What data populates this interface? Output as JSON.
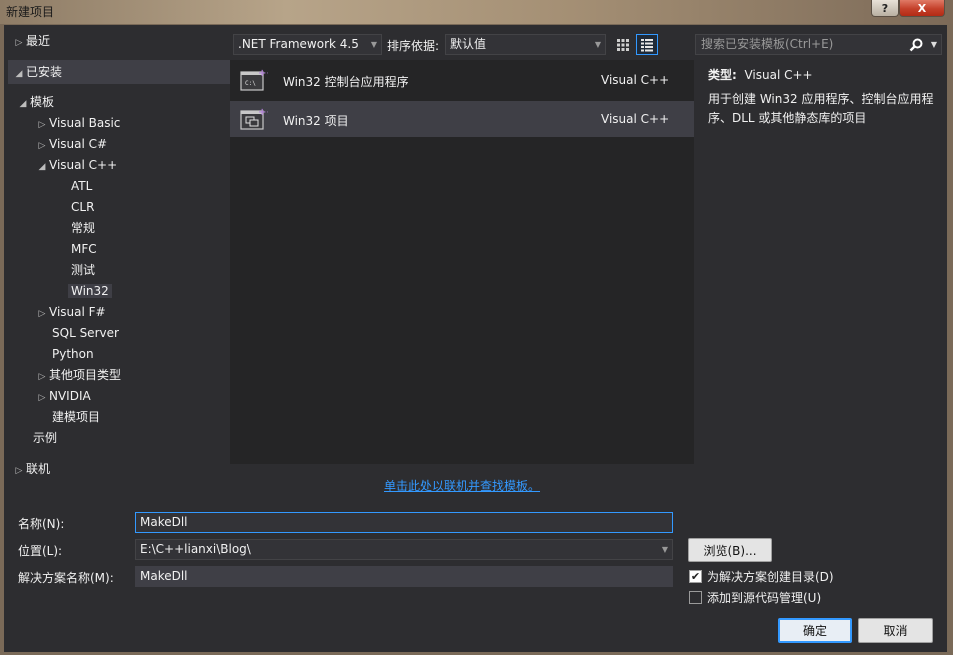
{
  "window": {
    "title": "新建项目",
    "help_glyph": "?",
    "close_glyph": "X"
  },
  "tree": {
    "recent": "最近",
    "installed": "已安装",
    "templates": "模板",
    "visual_basic": "Visual Basic",
    "visual_csharp": "Visual C#",
    "visual_cpp": "Visual C++",
    "cpp_children": [
      "ATL",
      "CLR",
      "常规",
      "MFC",
      "测试",
      "Win32"
    ],
    "visual_fsharp": "Visual F#",
    "sql_server": "SQL Server",
    "python": "Python",
    "other_types": "其他项目类型",
    "nvidia": "NVIDIA",
    "modeling": "建模项目",
    "samples": "示例",
    "online": "联机"
  },
  "toolbar": {
    "framework": ".NET Framework 4.5",
    "sort_label": "排序依据:",
    "sort_value": "默认值",
    "search_placeholder": "搜索已安装模板(Ctrl+E)"
  },
  "templates": [
    {
      "name": "Win32 控制台应用程序",
      "lang": "Visual C++"
    },
    {
      "name": "Win32 项目",
      "lang": "Visual C++"
    }
  ],
  "description": {
    "type_label": "类型:",
    "type_value": "Visual C++",
    "text": "用于创建 Win32 应用程序、控制台应用程序、DLL 或其他静态库的项目"
  },
  "online_link": "单击此处以联机并查找模板。",
  "form": {
    "name_label": "名称(N):",
    "name_value": "MakeDll",
    "location_label": "位置(L):",
    "location_value": "E:\\C++lianxi\\Blog\\",
    "solution_label": "解决方案名称(M):",
    "solution_value": "MakeDll",
    "browse": "浏览(B)...",
    "create_dir": "为解决方案创建目录(D)",
    "create_dir_checked": true,
    "add_source_control": "添加到源代码管理(U)",
    "add_source_control_checked": false,
    "ok": "确定",
    "cancel": "取消"
  },
  "colors": {
    "background": "#2d2d30",
    "list_background": "#252526",
    "selection": "#3f3f46",
    "accent": "#3399ff",
    "template_icon_plus": "#b180d7"
  }
}
